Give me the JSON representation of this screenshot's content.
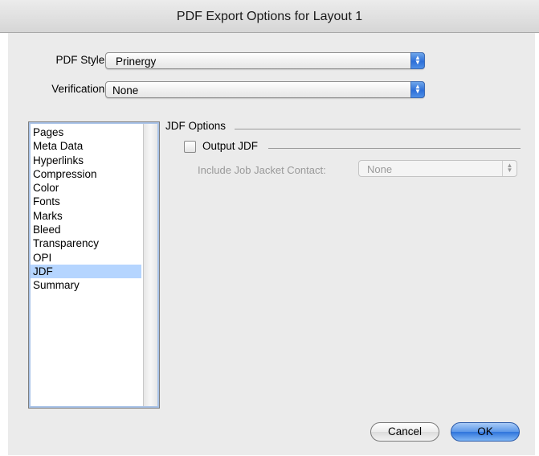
{
  "window": {
    "title": "PDF Export Options for Layout 1"
  },
  "pdf_style": {
    "label": "PDF Style:",
    "value": "Prinergy"
  },
  "verification": {
    "label": "Verification:",
    "value": "None"
  },
  "sidebar": {
    "items": [
      {
        "label": "Pages",
        "selected": false
      },
      {
        "label": "Meta Data",
        "selected": false
      },
      {
        "label": "Hyperlinks",
        "selected": false
      },
      {
        "label": "Compression",
        "selected": false
      },
      {
        "label": "Color",
        "selected": false
      },
      {
        "label": "Fonts",
        "selected": false
      },
      {
        "label": "Marks",
        "selected": false
      },
      {
        "label": "Bleed",
        "selected": false
      },
      {
        "label": "Transparency",
        "selected": false
      },
      {
        "label": "OPI",
        "selected": false
      },
      {
        "label": "JDF",
        "selected": true
      },
      {
        "label": "Summary",
        "selected": false
      }
    ]
  },
  "jdf": {
    "group_title": "JDF Options",
    "output_jdf": {
      "label": "Output JDF",
      "checked": false
    },
    "job_jacket": {
      "label": "Include Job Jacket Contact:",
      "value": "None",
      "enabled": false
    }
  },
  "buttons": {
    "cancel": "Cancel",
    "ok": "OK"
  },
  "colors": {
    "selection": "#b5d5ff",
    "accent": "#2f74dc",
    "disabled_text": "#9a9a9a"
  }
}
